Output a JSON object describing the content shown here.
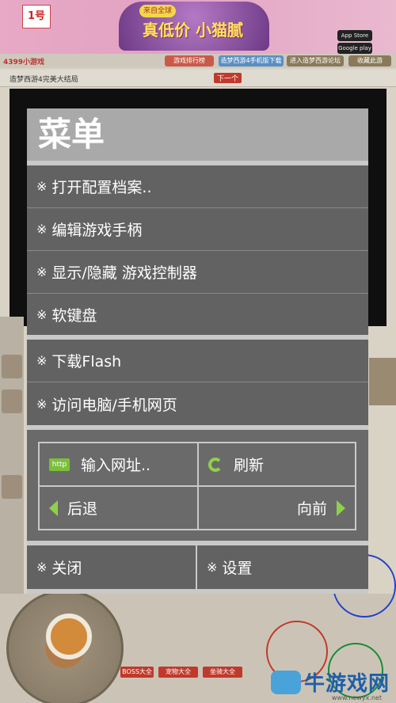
{
  "background": {
    "ad_logo": "1号",
    "ad_tag": "来自全球",
    "ad_title": "真低价 小猫腻",
    "store_badges": [
      "App Store",
      "Google play"
    ],
    "site_logo": "4399小游戏",
    "nav_buttons": [
      "游戏排行榜",
      "造梦西游4手机版下载",
      "进入造梦西游论坛",
      "收藏此游"
    ],
    "subbar_title": "造梦西游4完美大结局",
    "subbar_next": "下一个",
    "bottom_buttons": [
      "BOSS大全",
      "宠物大全",
      "坐骑大全"
    ],
    "watermark_text": "牛游戏网",
    "watermark_url": "www.newyx.net"
  },
  "menu": {
    "title": "菜单",
    "items": [
      {
        "label": "打开配置档案.."
      },
      {
        "label": "编辑游戏手柄"
      },
      {
        "label": "显示/隐藏 游戏控制器"
      },
      {
        "label": "软键盘"
      },
      {
        "label": "下载Flash"
      },
      {
        "label": "访问电脑/手机网页"
      }
    ],
    "mark": "※",
    "url_icon": "http",
    "url_label": "输入网址..",
    "refresh_label": "刷新",
    "back_label": "后退",
    "forward_label": "向前",
    "close_label": "关闭",
    "settings_label": "设置",
    "colors": {
      "panel": "#6a6a6a",
      "title_bar": "#a9a9a9",
      "separator": "#c9c9c9",
      "accent_green": "#8fd14a"
    }
  }
}
